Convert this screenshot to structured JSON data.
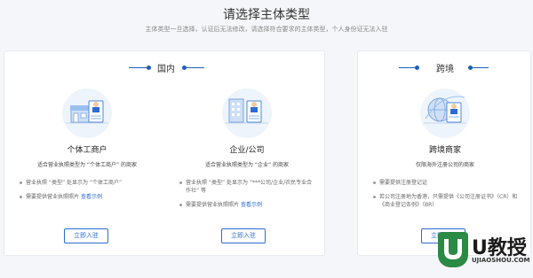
{
  "header": {
    "title": "请选择主体类型",
    "subtitle": "主体类型一旦选择，认证后无法修改，请选择符合要求的主体类型，个人身份证无法入驻"
  },
  "domestic": {
    "label": "国内",
    "types": [
      {
        "name": "个体工商户",
        "desc": "适合营业执照类型为 “个体工商户” 的商家",
        "bullets": [
          {
            "text": "营业执照 “类型” 处显示为 “个体工商户”",
            "link": ""
          },
          {
            "text": "需要提供营业执照照片",
            "link": "查看示例"
          }
        ],
        "button": "立即入驻"
      },
      {
        "name": "企业/公司",
        "desc": "适合营业执照类型为 “企业” 的商家",
        "bullets": [
          {
            "text": "营业执照 “类型” 处显示为 “***公司/企业/农民专业合作社” 等",
            "link": ""
          },
          {
            "text": "需要提供营业执照照片",
            "link": "查看示例"
          }
        ],
        "button": "立即入驻"
      }
    ]
  },
  "cross_border": {
    "label": "跨境",
    "type": {
      "name": "跨境商家",
      "desc": "仅限海外注册公司的商家",
      "bullets": [
        {
          "text": "需要提供注册登记证",
          "link": ""
        },
        {
          "text": "若公司注册地为香港，只需提供《公司注册证书》（CR）和《商业登记条例》（BR）",
          "link": ""
        }
      ],
      "button": "立即入驻"
    }
  },
  "watermark": {
    "brand": "U教授",
    "url": "UJIAOSHOU.COM"
  },
  "colors": {
    "accent": "#2c6cd1",
    "illustration_bg": "#eef4fc",
    "watermark_green": "#2a8a46"
  }
}
